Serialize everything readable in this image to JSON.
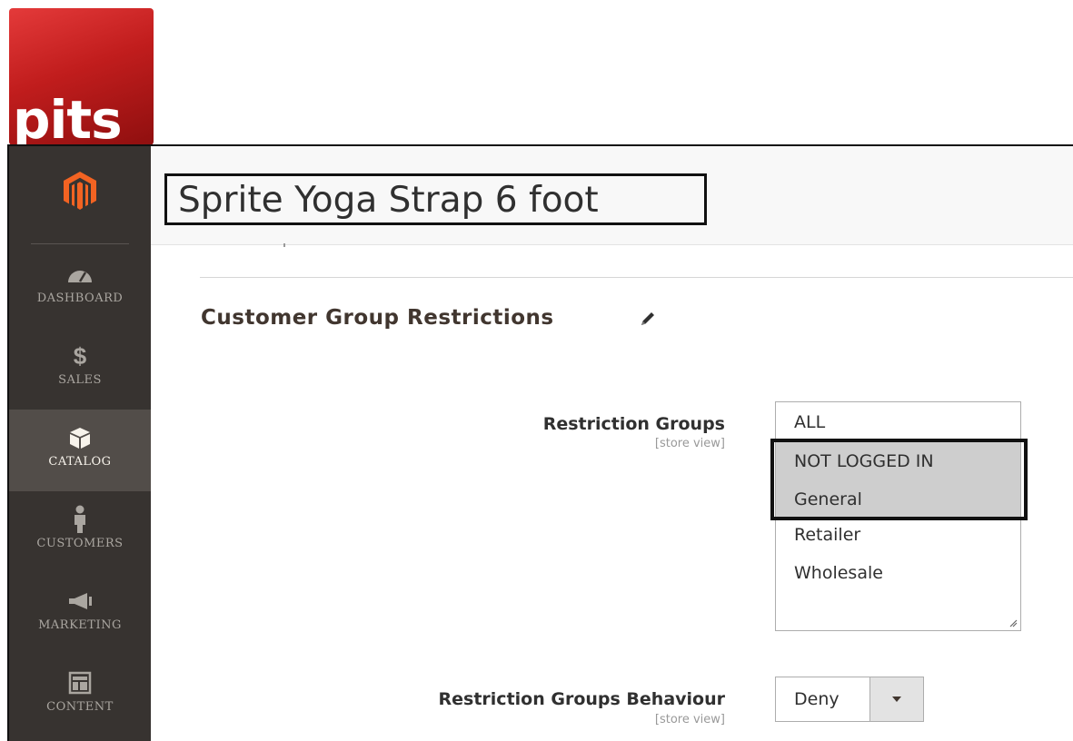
{
  "logo": {
    "text": "pits"
  },
  "sidebar": {
    "items": [
      {
        "label": "DASHBOARD",
        "icon": "dashboard-icon"
      },
      {
        "label": "SALES",
        "icon": "dollar-icon",
        "glyph": "$"
      },
      {
        "label": "CATALOG",
        "icon": "box-icon",
        "active": true
      },
      {
        "label": "CUSTOMERS",
        "icon": "person-icon"
      },
      {
        "label": "MARKETING",
        "icon": "megaphone-icon"
      },
      {
        "label": "CONTENT",
        "icon": "layout-icon"
      }
    ]
  },
  "header": {
    "title": "Sprite Yoga Strap 6 foot"
  },
  "section": {
    "title": "Customer Group Restrictions"
  },
  "fields": {
    "restriction_groups": {
      "label": "Restriction Groups",
      "scope": "[store view]",
      "options": [
        {
          "label": "ALL",
          "selected": false
        },
        {
          "label": "NOT LOGGED IN",
          "selected": true
        },
        {
          "label": "General",
          "selected": true
        },
        {
          "label": "Retailer",
          "selected": false
        },
        {
          "label": "Wholesale",
          "selected": false
        }
      ]
    },
    "restriction_behaviour": {
      "label": "Restriction Groups Behaviour",
      "scope": "[store view]",
      "value": "Deny"
    }
  },
  "colors": {
    "sidebar_bg": "#373330",
    "sidebar_active": "#524d49",
    "logo_red": "#c11d1d",
    "selected_option": "#cecece"
  }
}
